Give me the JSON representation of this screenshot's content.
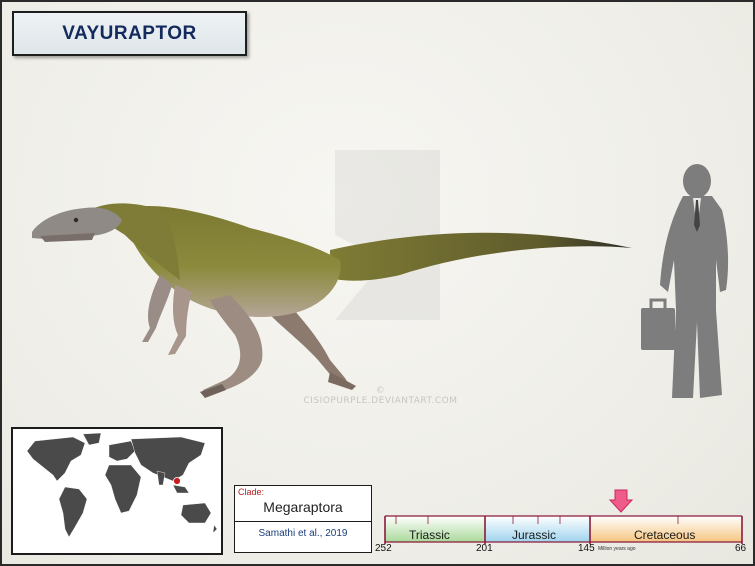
{
  "title": "VAYURAPTOR",
  "watermark": "© CISIOPURPLE.DEVIANTART.COM",
  "clade": {
    "label": "Clade:",
    "name": "Megaraptora",
    "author": "Samathi et al., 2019"
  },
  "timeline": {
    "periods": [
      {
        "name": "Triassic",
        "start": 252,
        "end": 201
      },
      {
        "name": "Jurassic",
        "start": 201,
        "end": 145
      },
      {
        "name": "Cretaceous",
        "start": 145,
        "end": 66
      }
    ],
    "tick_labels": [
      "252",
      "201",
      "145",
      "66"
    ],
    "unit_label": "Million years ago",
    "marker_mya": 125
  },
  "map": {
    "location_marker_color": "#c81e1e"
  },
  "colors": {
    "title_text": "#132a5e",
    "clade_label": "#b01e1e",
    "author_text": "#1a3c7a",
    "timeline_axis": "#8b1a3a",
    "marker": "#ef5b8a",
    "silhouette": "#7d7d7d"
  }
}
